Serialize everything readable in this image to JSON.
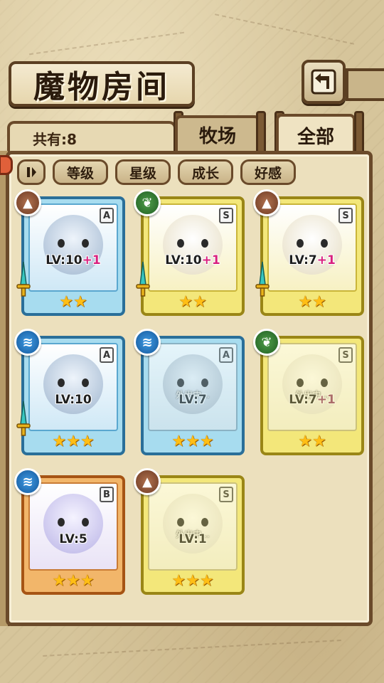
{
  "header": {
    "title": "魔物房间"
  },
  "tabs": {
    "count_label": "共有:8",
    "farm_label": "牧场",
    "all_label": "全部"
  },
  "filters": {
    "level": "等级",
    "star": "星级",
    "growth": "成长",
    "affection": "好感"
  },
  "monsters": [
    {
      "element": "earth-icon",
      "rank": "A",
      "frame": "blue",
      "level": "LV:10",
      "bonus": "+1",
      "stars": "★★",
      "away": "",
      "has_sword": true
    },
    {
      "element": "wood-icon",
      "rank": "S",
      "frame": "yellow",
      "level": "LV:10",
      "bonus": "+1",
      "stars": "★★",
      "away": "",
      "has_sword": true
    },
    {
      "element": "earth-icon",
      "rank": "S",
      "frame": "yellow",
      "level": "LV:7",
      "bonus": "+1",
      "stars": "★★",
      "away": "",
      "has_sword": true
    },
    {
      "element": "water-icon",
      "rank": "A",
      "frame": "blue",
      "level": "LV:10",
      "bonus": "",
      "stars": "★★★",
      "away": "",
      "has_sword": true
    },
    {
      "element": "water-icon",
      "rank": "A",
      "frame": "blue",
      "level": "LV:7",
      "bonus": "",
      "stars": "★★★",
      "away": "外出中...",
      "has_sword": false
    },
    {
      "element": "wood-icon",
      "rank": "S",
      "frame": "yellow",
      "level": "LV:7",
      "bonus": "+1",
      "stars": "★★",
      "away": "外出中...",
      "has_sword": false
    },
    {
      "element": "water-icon",
      "rank": "B",
      "frame": "orange",
      "level": "LV:5",
      "bonus": "",
      "stars": "★★★",
      "away": "",
      "has_sword": false
    },
    {
      "element": "earth-icon",
      "rank": "S",
      "frame": "yellow",
      "level": "LV:1",
      "bonus": "",
      "stars": "★★★",
      "away": "外出中...",
      "has_sword": false
    }
  ],
  "colors": {
    "blue_frame": "#2a6f99",
    "yellow_frame": "#9a8616",
    "orange_frame": "#a65414",
    "bonus": "#d8207e",
    "star": "#ffbe14"
  }
}
